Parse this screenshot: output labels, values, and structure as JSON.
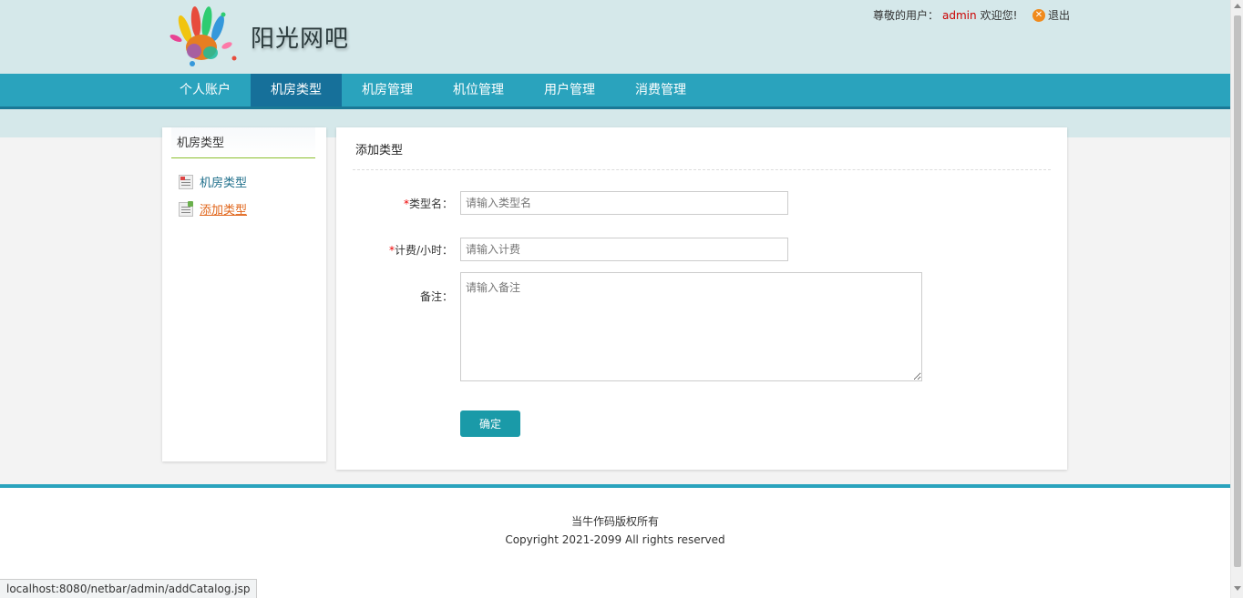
{
  "header": {
    "site_title": "阳光网吧",
    "greeting_prefix": "尊敬的用户：",
    "username": "admin",
    "greeting_suffix": "欢迎您!",
    "logout_label": "退出",
    "logo_icon": "colorful-hands-logo",
    "logout_icon": "close-circle-icon"
  },
  "nav": {
    "items": [
      {
        "label": "个人账户",
        "active": false
      },
      {
        "label": "机房类型",
        "active": true
      },
      {
        "label": "机房管理",
        "active": false
      },
      {
        "label": "机位管理",
        "active": false
      },
      {
        "label": "用户管理",
        "active": false
      },
      {
        "label": "消费管理",
        "active": false
      }
    ]
  },
  "sidebar": {
    "title": "机房类型",
    "links": [
      {
        "label": "机房类型",
        "icon": "list-icon"
      },
      {
        "label": "添加类型",
        "icon": "add-document-icon"
      }
    ]
  },
  "form": {
    "title": "添加类型",
    "required_mark": "*",
    "fields": [
      {
        "label": "类型名：",
        "placeholder": "请输入类型名",
        "value": "",
        "required": true
      },
      {
        "label": "计费/小时：",
        "placeholder": "请输入计费",
        "value": "",
        "required": true
      },
      {
        "label": "备注：",
        "placeholder": "请输入备注",
        "value": "",
        "required": false
      }
    ],
    "submit_label": "确定"
  },
  "footer": {
    "line1": "当牛作码版权所有",
    "line2": "Copyright 2021-2099 All rights reserved"
  },
  "statusbar": {
    "url": "localhost:8080/netbar/admin/addCatalog.jsp"
  },
  "colors": {
    "nav_bg": "#2aa3bd",
    "nav_active": "#16709a",
    "header_bg": "#d5e8ea",
    "button_bg": "#1a9aa8",
    "username_color": "#cc0000",
    "active_link": "#e0651a"
  }
}
